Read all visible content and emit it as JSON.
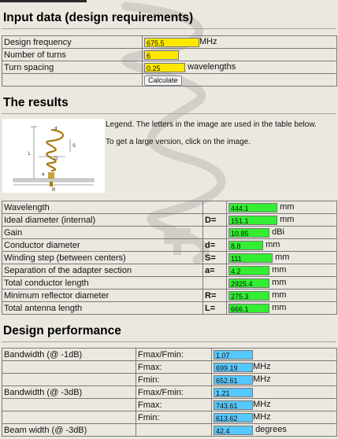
{
  "input_section": {
    "title": "Input data (design requirements)",
    "rows": [
      {
        "label": "Design frequency",
        "value": "675.5",
        "unit": "MHz"
      },
      {
        "label": "Number of turns",
        "value": "6",
        "unit": ""
      },
      {
        "label": "Turn spacing",
        "value": "0.25",
        "unit": "wavelengths"
      }
    ],
    "calculate_label": "Calculate"
  },
  "results_section": {
    "title": "The results",
    "legend_text": "Legend. The letters in the image are used in the table below.",
    "large_version_text": "To get a large version, click on the image.",
    "diagram_labels": {
      "d": "d",
      "D": "D",
      "s": "S",
      "L": "L",
      "a": "a",
      "R": "R"
    },
    "rows": [
      {
        "label": "Wavelength",
        "symbol": "",
        "value": "444.1",
        "unit": "mm"
      },
      {
        "label": "Ideal diameter (internal)",
        "symbol": "D=",
        "value": "151.1",
        "unit": "mm"
      },
      {
        "label": "Gain",
        "symbol": "",
        "value": "10.85",
        "unit": "dBi"
      },
      {
        "label": "Conductor diameter",
        "symbol": "d=",
        "value": "8.8",
        "unit": "mm"
      },
      {
        "label": "Winding step (between centers)",
        "symbol": "S=",
        "value": "111",
        "unit": "mm"
      },
      {
        "label": "Separation of the adapter section",
        "symbol": "a=",
        "value": "4.2",
        "unit": "mm"
      },
      {
        "label": "Total conductor length",
        "symbol": "",
        "value": "2925.4",
        "unit": "mm"
      },
      {
        "label": "Minimum reflector diameter",
        "symbol": "R=",
        "value": "275.3",
        "unit": "mm"
      },
      {
        "label": "Total antenna length",
        "symbol": "L=",
        "value": "666.1",
        "unit": "mm"
      }
    ]
  },
  "performance_section": {
    "title": "Design performance",
    "rows": [
      {
        "label": "Bandwidth (@ -1dB)",
        "param": "Fmax/Fmin:",
        "value": "1.07",
        "unit": ""
      },
      {
        "label": "",
        "param": "Fmax:",
        "value": "699.19",
        "unit": "MHz"
      },
      {
        "label": "",
        "param": "Fmin:",
        "value": "652.61",
        "unit": "MHz"
      },
      {
        "label": "Bandwidth (@ -3dB)",
        "param": "Fmax/Fmin:",
        "value": "1.21",
        "unit": ""
      },
      {
        "label": "",
        "param": "Fmax:",
        "value": "743.61",
        "unit": "MHz"
      },
      {
        "label": "",
        "param": "Fmin:",
        "value": "613.62",
        "unit": "MHz"
      },
      {
        "label": "Beam width (@ -3dB)",
        "param": "",
        "value": "42.4",
        "unit": "degrees"
      }
    ]
  },
  "colors": {
    "background": "#ebe8e0",
    "input_field": "#ffe800",
    "result_field": "#33ee33",
    "performance_field": "#55c8ff"
  }
}
